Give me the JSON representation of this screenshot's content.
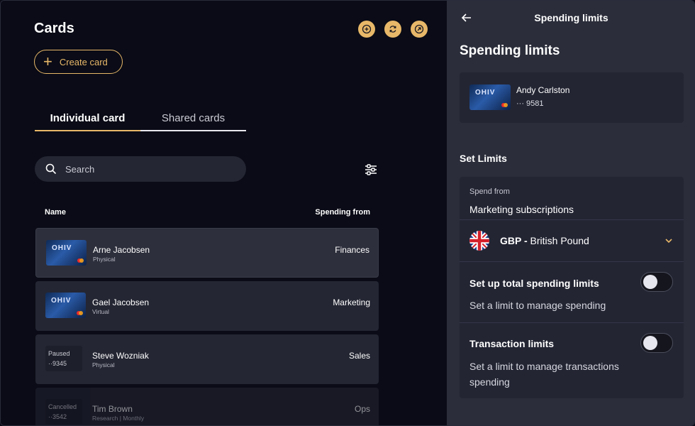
{
  "cards_panel": {
    "title": "Cards",
    "create_button": "Create card",
    "tabs": [
      {
        "label": "Individual card",
        "active": true
      },
      {
        "label": "Shared cards",
        "active": false
      }
    ],
    "search": {
      "placeholder": "Search"
    },
    "columns": {
      "name": "Name",
      "spending_from": "Spending from"
    },
    "rows": [
      {
        "name": "Arne Jacobsen",
        "type": "Physical",
        "spending_from": "Finances",
        "thumb": "card-image"
      },
      {
        "name": "Gael Jacobsen",
        "type": "Virtual",
        "spending_from": "Marketing",
        "thumb": "card-image"
      },
      {
        "name": "Steve Wozniak",
        "type": "Physical",
        "spending_from": "Sales",
        "status": "Paused",
        "last4": "··9345"
      },
      {
        "name": "Tim Brown",
        "type": "Research | Monthly",
        "spending_from": "Ops",
        "status": "Cancelled",
        "last4": "··3542"
      }
    ],
    "card_brand": "OHIV"
  },
  "limits_panel": {
    "header_title": "Spending limits",
    "title": "Spending limits",
    "holder": {
      "name": "Andy Carlston",
      "last4": "··· 9581"
    },
    "section_title": "Set Limits",
    "spend_from_label": "Spend from",
    "spend_from_value": "Marketing subscriptions",
    "currency_code": "GBP",
    "currency_sep": " - ",
    "currency_name": "British Pound",
    "total_limits": {
      "title": "Set up total spending limits",
      "desc": "Set a limit to manage spending",
      "enabled": false
    },
    "transaction_limits": {
      "title": "Transaction limits",
      "desc": "Set a limit to manage transactions spending",
      "enabled": false
    }
  },
  "colors": {
    "accent": "#e8b869",
    "bg_dark": "#0a0b16",
    "panel": "#2b2d3a",
    "row": "#242633"
  },
  "icons": [
    "plus-circle-icon",
    "refresh-icon",
    "arrow-up-right-icon",
    "search-icon",
    "filter-sliders-icon",
    "back-arrow-icon",
    "uk-flag-icon",
    "chevron-down-icon"
  ]
}
